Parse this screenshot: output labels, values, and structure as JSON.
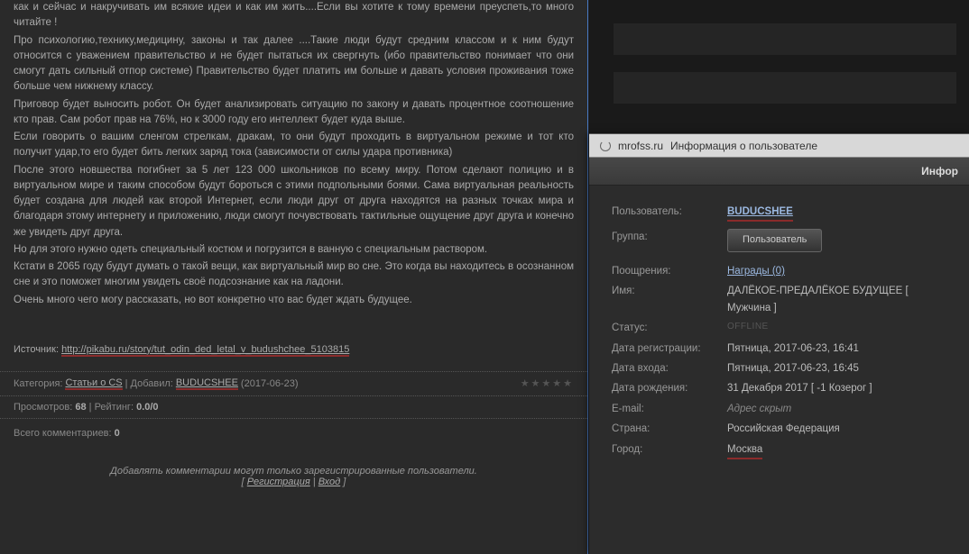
{
  "article": {
    "paragraphs": [
      "как и сейчас и накручивать им всякие идеи и как им жить....Если вы хотите к тому времени преуспеть,то много читайте !",
      "Про психологию,технику,медицину, законы и так далее ....Такие люди будут средним классом и к ним будут относится с уважением правительство и не будет пытаться их свергнуть (ибо правительство понимает что они смогут дать сильный отпор системе) Правительство будет платить им больше и давать условия проживания тоже больше чем нижнему классу.",
      "Приговор будет выносить робот. Он будет анализировать ситуацию по закону и давать процентное соотношение кто прав. Сам робот прав на 76%, но к 3000 году его интеллект будет куда выше.",
      "Если говорить о вашим сленгом стрелкам, дракам, то они будут проходить в виртуальном режиме и тот кто получит удар,то его будет бить легких заряд тока (зависимости от силы удара противника)",
      "После этого новшества погибнет за 5 лет 123 000 школьников по всему миру. Потом сделают полицию и в виртуальном мире и таким способом будут бороться с этими подпольными боями. Сама виртуальная реальность будет создана для людей как второй Интернет, если люди друг от друга находятся на разных точках мира и благодаря этому интернету и приложению, люди смогут почувствовать тактильные ощущение друг друга и конечно же увидеть друг друга.",
      "Но для этого нужно одеть специальный костюм и погрузится в ванную с специальным раствором.",
      "Кстати в 2065 году будут думать о такой вещи, как виртуальный мир во сне. Это когда вы находитесь в осознанном сне и это поможет многим увидеть своё подсознание как на ладони.",
      "Очень много чего могу рассказать, но вот конкретно что вас будет ждать будущее."
    ]
  },
  "source": {
    "label": "Источник:",
    "url_text": "http://pikabu.ru/story/tut_odin_ded_letal_v_budushchee_5103815"
  },
  "meta": {
    "category_label": "Категория:",
    "category": "Статьи о CS",
    "added_by_label": "Добавил:",
    "user": "BUDUCSHEE",
    "date": "(2017-06-23)",
    "views_label": "Просмотров:",
    "views": "68",
    "rating_label": "Рейтинг:",
    "rating": "0.0/0",
    "comments_label": "Всего комментариев:",
    "comments": "0"
  },
  "comment_form": {
    "text": "Добавлять комментарии могут только зарегистрированные пользователи.",
    "register": "Регистрация",
    "login": "Вход"
  },
  "popup": {
    "tab_domain": "mrofss.ru",
    "tab_title": "Информация о пользователе",
    "header": "Инфор",
    "rows": {
      "user_label": "Пользователь:",
      "user_value": "BUDUCSHEE",
      "group_label": "Группа:",
      "group_value": "Пользователь",
      "rewards_label": "Поощрения:",
      "rewards_value": "Награды (0)",
      "name_label": "Имя:",
      "name_value": "ДАЛЁКОЕ-ПРЕДАЛЁКОЕ БУДУЩЕЕ [ Мужчина ]",
      "status_label": "Статус:",
      "status_value": "OFFLINE",
      "reg_label": "Дата регистрации:",
      "reg_value": "Пятница, 2017-06-23, 16:41",
      "login_label": "Дата входа:",
      "login_value": "Пятница, 2017-06-23, 16:45",
      "birth_label": "Дата рождения:",
      "birth_value": "31 Декабря 2017 [ -1 Козерог ]",
      "email_label": "E-mail:",
      "email_value": "Адрес скрыт",
      "country_label": "Страна:",
      "country_value": "Российская Федерация",
      "city_label": "Город:",
      "city_value": "Москва"
    }
  }
}
